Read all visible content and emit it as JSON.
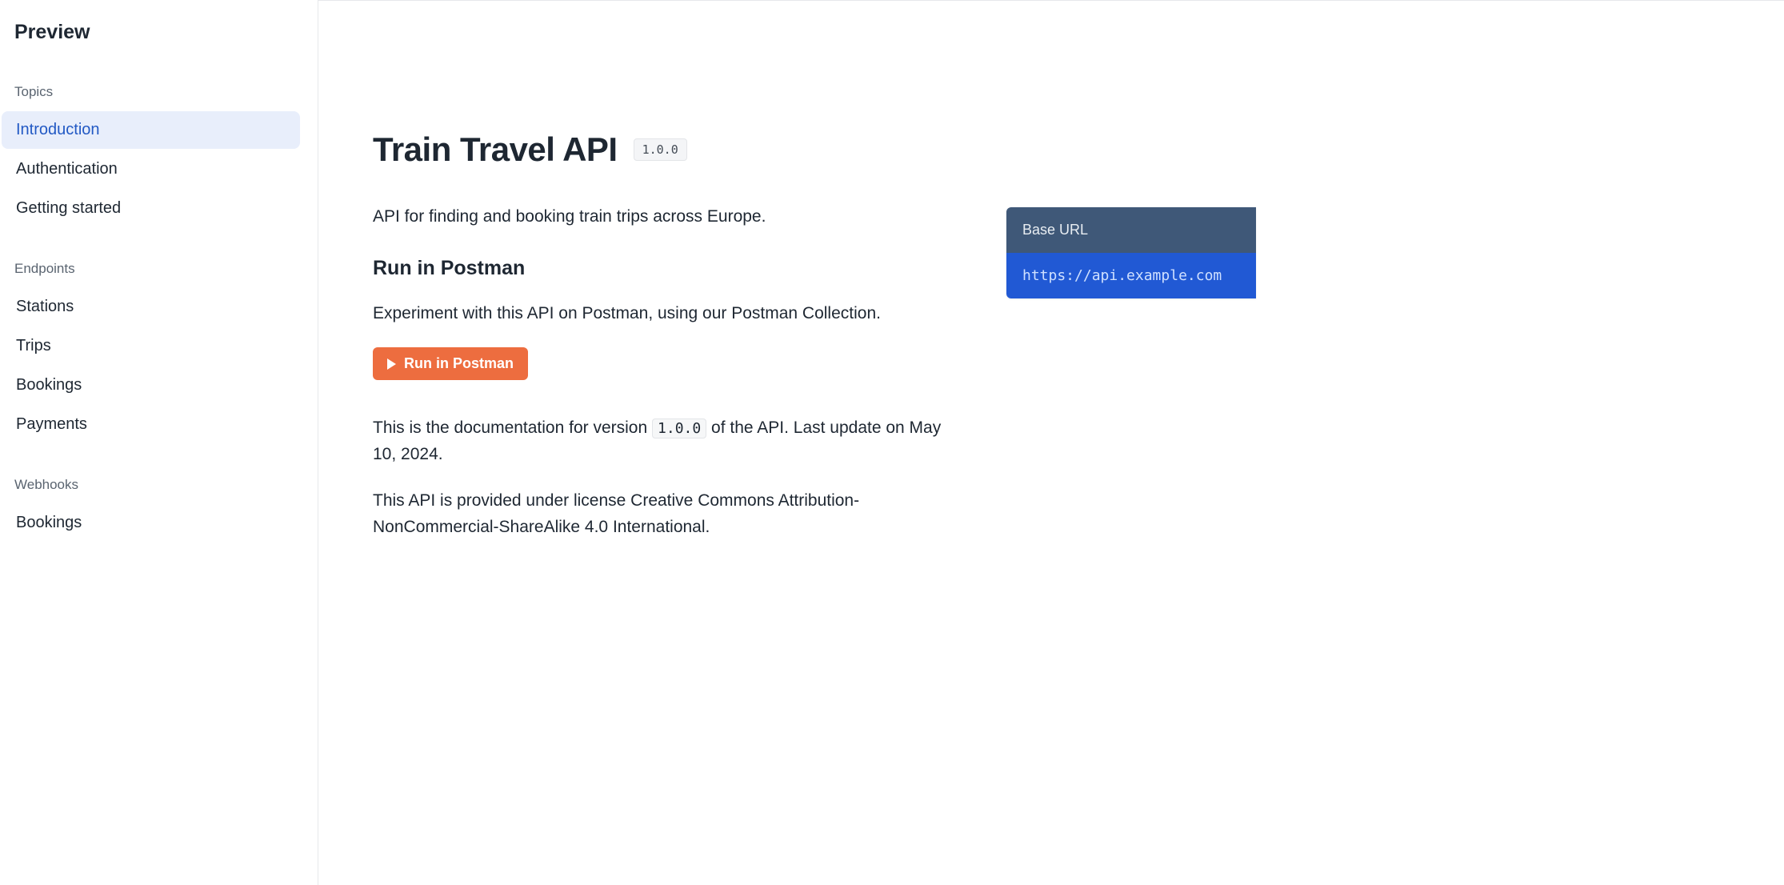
{
  "sidebar": {
    "title": "Preview",
    "sections": [
      {
        "heading": "Topics",
        "items": [
          {
            "label": "Introduction",
            "active": true
          },
          {
            "label": "Authentication",
            "active": false
          },
          {
            "label": "Getting started",
            "active": false
          }
        ]
      },
      {
        "heading": "Endpoints",
        "items": [
          {
            "label": "Stations",
            "active": false
          },
          {
            "label": "Trips",
            "active": false
          },
          {
            "label": "Bookings",
            "active": false
          },
          {
            "label": "Payments",
            "active": false
          }
        ]
      },
      {
        "heading": "Webhooks",
        "items": [
          {
            "label": "Bookings",
            "active": false
          }
        ]
      }
    ]
  },
  "content": {
    "title": "Train Travel API",
    "version": "1.0.0",
    "intro": "API for finding and booking train trips across Europe.",
    "postman": {
      "heading": "Run in Postman",
      "description": "Experiment with this API on Postman, using our Postman Collection.",
      "button_label": "Run in Postman"
    },
    "docline_pre": "This is the documentation for version ",
    "docline_version": "1.0.0",
    "docline_post": " of the API. Last update on May 10, 2024.",
    "license": "This API is provided under license Creative Commons Attribution-NonCommercial-ShareAlike 4.0 International."
  },
  "baseurl": {
    "label": "Base URL",
    "value": "https://api.example.com"
  }
}
